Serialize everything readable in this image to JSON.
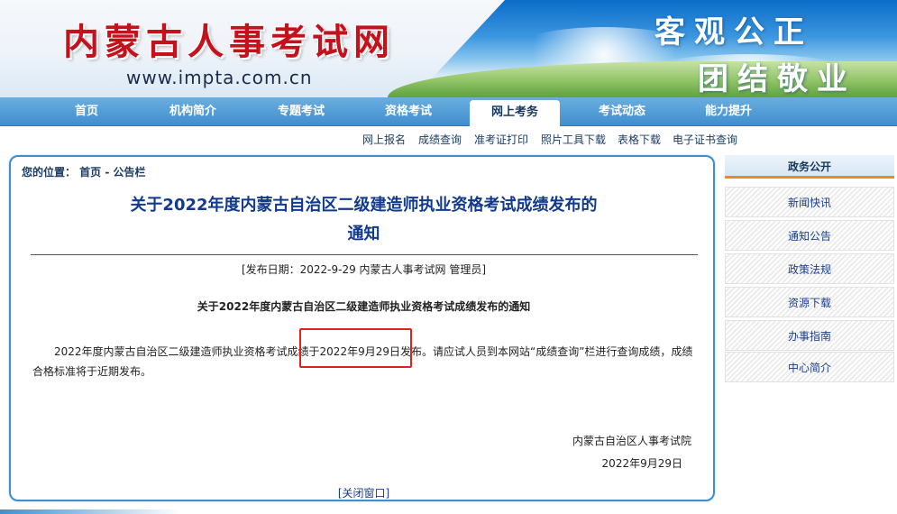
{
  "banner": {
    "site_title": "内蒙古人事考试网",
    "site_url": "www.impta.com.cn",
    "slogan_line1": "客观公正",
    "slogan_line2": "团结敬业"
  },
  "nav": {
    "items": [
      {
        "label": "首页"
      },
      {
        "label": "机构简介"
      },
      {
        "label": "专题考试"
      },
      {
        "label": "资格考试"
      },
      {
        "label": "网上考务",
        "active": true
      },
      {
        "label": "考试动态"
      },
      {
        "label": "能力提升"
      }
    ]
  },
  "subnav": {
    "items": [
      {
        "label": "网上报名"
      },
      {
        "label": "成绩查询"
      },
      {
        "label": "准考证打印"
      },
      {
        "label": "照片工具下载"
      },
      {
        "label": "表格下载"
      },
      {
        "label": "电子证书查询"
      }
    ]
  },
  "main": {
    "breadcrumb": "您的位置： 首页 - 公告栏",
    "headline_line1": "关于2022年度内蒙古自治区二级建造师执业资格考试成绩发布的",
    "headline_line2": "通知",
    "meta": "[发布日期：2022-9-29 内蒙古人事考试网 管理员]",
    "subtitle": "关于2022年度内蒙古自治区二级建造师执业资格考试成绩发布的通知",
    "body": "2022年度内蒙古自治区二级建造师执业资格考试成绩于2022年9月29日发布。请应试人员到本网站“成绩查询”栏进行查询成绩，成绩合格标准将于近期发布。",
    "signature_org": "内蒙古自治区人事考试院",
    "signature_date": "2022年9月29日",
    "close_link": "[关闭窗口]"
  },
  "sidebar": {
    "header": "政务公开",
    "items": [
      {
        "label": "新闻快讯"
      },
      {
        "label": "通知公告"
      },
      {
        "label": "政策法规"
      },
      {
        "label": "资源下载"
      },
      {
        "label": "办事指南"
      },
      {
        "label": "中心简介"
      }
    ]
  },
  "colors": {
    "nav_blue": "#3f8fcf",
    "headline_blue": "#123a8c",
    "title_red": "#c4111b",
    "highlight_red": "#e0221b",
    "sidebar_accent": "#f08a1c"
  }
}
